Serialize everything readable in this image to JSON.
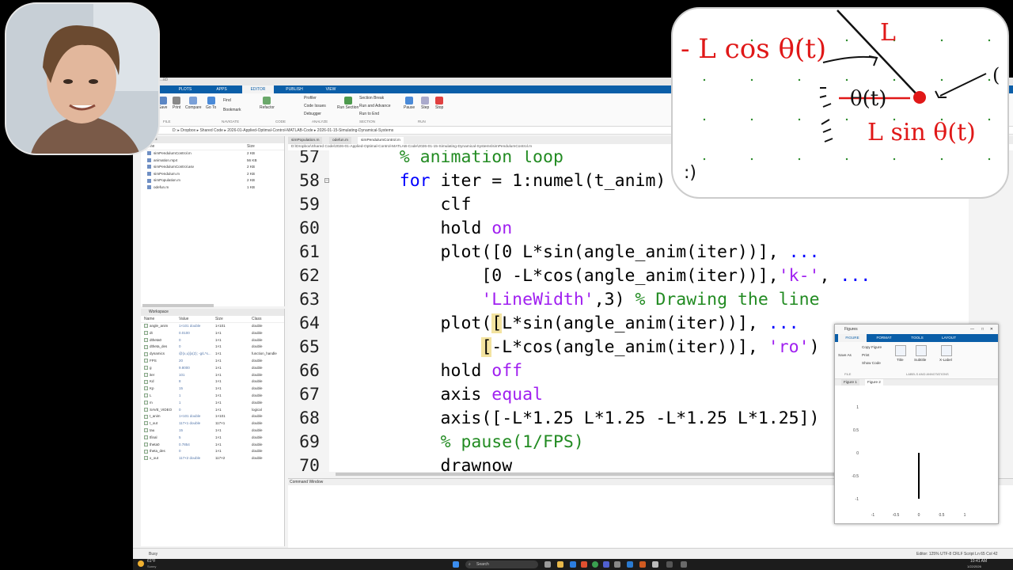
{
  "matlab": {
    "ribbon_tabs": [
      "PLOTS",
      "APPS",
      "EDITOR",
      "PUBLISH",
      "VIEW"
    ],
    "ribbon_buttons": [
      "Save",
      "Print",
      "Compare",
      "Go To",
      "Find",
      "Bookmark",
      "Refactor",
      "Profiler",
      "Code Issues",
      "Debugger",
      "Run Section",
      "Section Break",
      "Run and Advance",
      "Run to End",
      "Pause",
      "Step",
      "Stop"
    ],
    "ribbon_groups": [
      "FILE",
      "NAVIGATE",
      "CODE",
      "ANALYZE",
      "SECTION",
      "RUN"
    ],
    "address": "D: ▸ Dropbox ▸ Shared Code ▸ 2026-01-Applied-Optimal-Control-MATLAB-Code ▸ 2026-01-15-Simulating-Dynamical-Systems",
    "files": {
      "title": "Files",
      "columns": [
        "Name",
        "Size"
      ],
      "rows": [
        {
          "name": "simPendulumControl.m",
          "size": "2 KB"
        },
        {
          "name": "animation.mp4",
          "size": "56 KB"
        },
        {
          "name": "simPendulumControl.asv",
          "size": "2 KB"
        },
        {
          "name": "simPendulum.m",
          "size": "2 KB"
        },
        {
          "name": "simPopulation.m",
          "size": "2 KB"
        },
        {
          "name": "odefun.m",
          "size": "1 KB"
        }
      ]
    },
    "workspace": {
      "title": "Workspace",
      "columns": [
        "Name",
        "Value",
        "Size",
        "Class"
      ],
      "rows": [
        [
          "angle_anim",
          "1×101 double",
          "1×101",
          "double"
        ],
        [
          "dt",
          "0.0100",
          "1×1",
          "double"
        ],
        [
          "dtheta0",
          "0",
          "1×1",
          "double"
        ],
        [
          "dtheta_des",
          "0",
          "1×1",
          "double"
        ],
        [
          "dynamics",
          "@(x,u)[x(2); -g/L*s...",
          "1×1",
          "function_handle"
        ],
        [
          "FPS",
          "20",
          "1×1",
          "double"
        ],
        [
          "g",
          "9.8000",
          "1×1",
          "double"
        ],
        [
          "iter",
          "101",
          "1×1",
          "double"
        ],
        [
          "Kd",
          "8",
          "1×1",
          "double"
        ],
        [
          "Kp",
          "15",
          "1×1",
          "double"
        ],
        [
          "L",
          "1",
          "1×1",
          "double"
        ],
        [
          "m",
          "1",
          "1×1",
          "double"
        ],
        [
          "SAVE_VIDEO",
          "0",
          "1×1",
          "logical"
        ],
        [
          "t_anim",
          "1×101 double",
          "1×101",
          "double"
        ],
        [
          "t_out",
          "117×1 double",
          "117×1",
          "double"
        ],
        [
          "tau",
          "15",
          "1×1",
          "double"
        ],
        [
          "tfinal",
          "5",
          "1×1",
          "double"
        ],
        [
          "theta0",
          "0.7854",
          "1×1",
          "double"
        ],
        [
          "theta_des",
          "0",
          "1×1",
          "double"
        ],
        [
          "x_out",
          "117×2 double",
          "117×2",
          "double"
        ]
      ]
    },
    "editor": {
      "tabs": [
        "simPopulation.m",
        "odefun.m",
        "simPendulumControl.m"
      ],
      "path": "D:\\Dropbox\\Shared Code\\2026-01-Applied-Optimal-Control-MATLAB-Code\\2026-01-15-Simulating-Dynamical-Systems\\simPendulumControl.m",
      "lines": [
        {
          "n": "57",
          "parts": [
            [
              "    ",
              ""
            ],
            [
              "% animation loop",
              "cm"
            ]
          ]
        },
        {
          "n": "58",
          "parts": [
            [
              "    ",
              ""
            ],
            [
              "for",
              "kw"
            ],
            [
              " iter = 1:numel(t_anim)",
              ""
            ]
          ]
        },
        {
          "n": "59",
          "parts": [
            [
              "        clf",
              ""
            ]
          ]
        },
        {
          "n": "60",
          "parts": [
            [
              "        hold ",
              ""
            ],
            [
              "on",
              "st"
            ]
          ]
        },
        {
          "n": "61",
          "parts": [
            [
              "        plot([0 L*sin(angle_anim(iter))], ",
              ""
            ],
            [
              "...",
              "kw"
            ]
          ]
        },
        {
          "n": "62",
          "parts": [
            [
              "            [0 -L*cos(angle_anim(iter))],",
              ""
            ],
            [
              "'k-'",
              "st"
            ],
            [
              ", ",
              ""
            ],
            [
              "...",
              "kw"
            ]
          ]
        },
        {
          "n": "63",
          "parts": [
            [
              "            ",
              ""
            ],
            [
              "'LineWidth'",
              "st"
            ],
            [
              ",3) ",
              ""
            ],
            [
              "% Drawing the line",
              "cm"
            ]
          ]
        },
        {
          "n": "64",
          "parts": [
            [
              "        plot(",
              ""
            ],
            [
              "[",
              "hl"
            ],
            [
              "L*sin(angle_anim(iter))], ",
              ""
            ],
            [
              "...",
              "kw"
            ]
          ]
        },
        {
          "n": "65",
          "parts": [
            [
              "            ",
              ""
            ],
            [
              "[",
              "hl"
            ],
            [
              "-L*cos(angle_anim(iter))], ",
              ""
            ],
            [
              "'ro'",
              "st"
            ],
            [
              ")",
              ""
            ]
          ]
        },
        {
          "n": "66",
          "parts": [
            [
              "        hold ",
              ""
            ],
            [
              "off",
              "st"
            ]
          ]
        },
        {
          "n": "67",
          "parts": [
            [
              "        axis ",
              ""
            ],
            [
              "equal",
              "st"
            ]
          ]
        },
        {
          "n": "68",
          "parts": [
            [
              "        axis([-L*1.25 L*1.25 -L*1.25 L*1.25])",
              ""
            ]
          ]
        },
        {
          "n": "69",
          "parts": [
            [
              "        ",
              ""
            ],
            [
              "% pause(1/FPS)",
              "cm"
            ]
          ]
        },
        {
          "n": "70",
          "parts": [
            [
              "        drawnow",
              ""
            ]
          ]
        }
      ]
    },
    "command_window": "Command Window",
    "status": {
      "left": "Busy",
      "right": "Editor: 125%   UTF-8   CRLF   Script   Ln 65  Col 42"
    }
  },
  "figure": {
    "title": "Figures",
    "tabs": [
      "FIGURE",
      "FORMAT",
      "TOOLS",
      "LAYOUT"
    ],
    "buttons": [
      "Save As",
      "Copy Figure",
      "Print",
      "Show Code",
      "Title",
      "Subtitle",
      "X-Label"
    ],
    "groups": [
      "FILE",
      "LABELS AND ANNOTATIONS"
    ],
    "doc_tabs": [
      "Figure 1",
      "Figure 2"
    ],
    "y_ticks": [
      "1",
      "0.5",
      "0",
      "-0.5",
      "-1"
    ],
    "x_ticks": [
      "-1",
      "-0.5",
      "0",
      "0.5",
      "1"
    ]
  },
  "taskbar": {
    "weather_temp": "61°F",
    "weather_desc": "Sunny",
    "search": "Search",
    "time": "10:41 AM",
    "date": "1/22/2026"
  },
  "whiteboard": {
    "left_expr": "- L cos θ(t)",
    "top_label": "L",
    "theta": "θ(t)",
    "bottom_expr": "L sin θ(t)",
    "face": ":)",
    "paren": "("
  },
  "colors": {
    "ribbon_blue": "#0a5ea8",
    "keyword": "#0000ff",
    "comment": "#228b22",
    "string": "#a020f0",
    "ink_red": "#e01818"
  }
}
